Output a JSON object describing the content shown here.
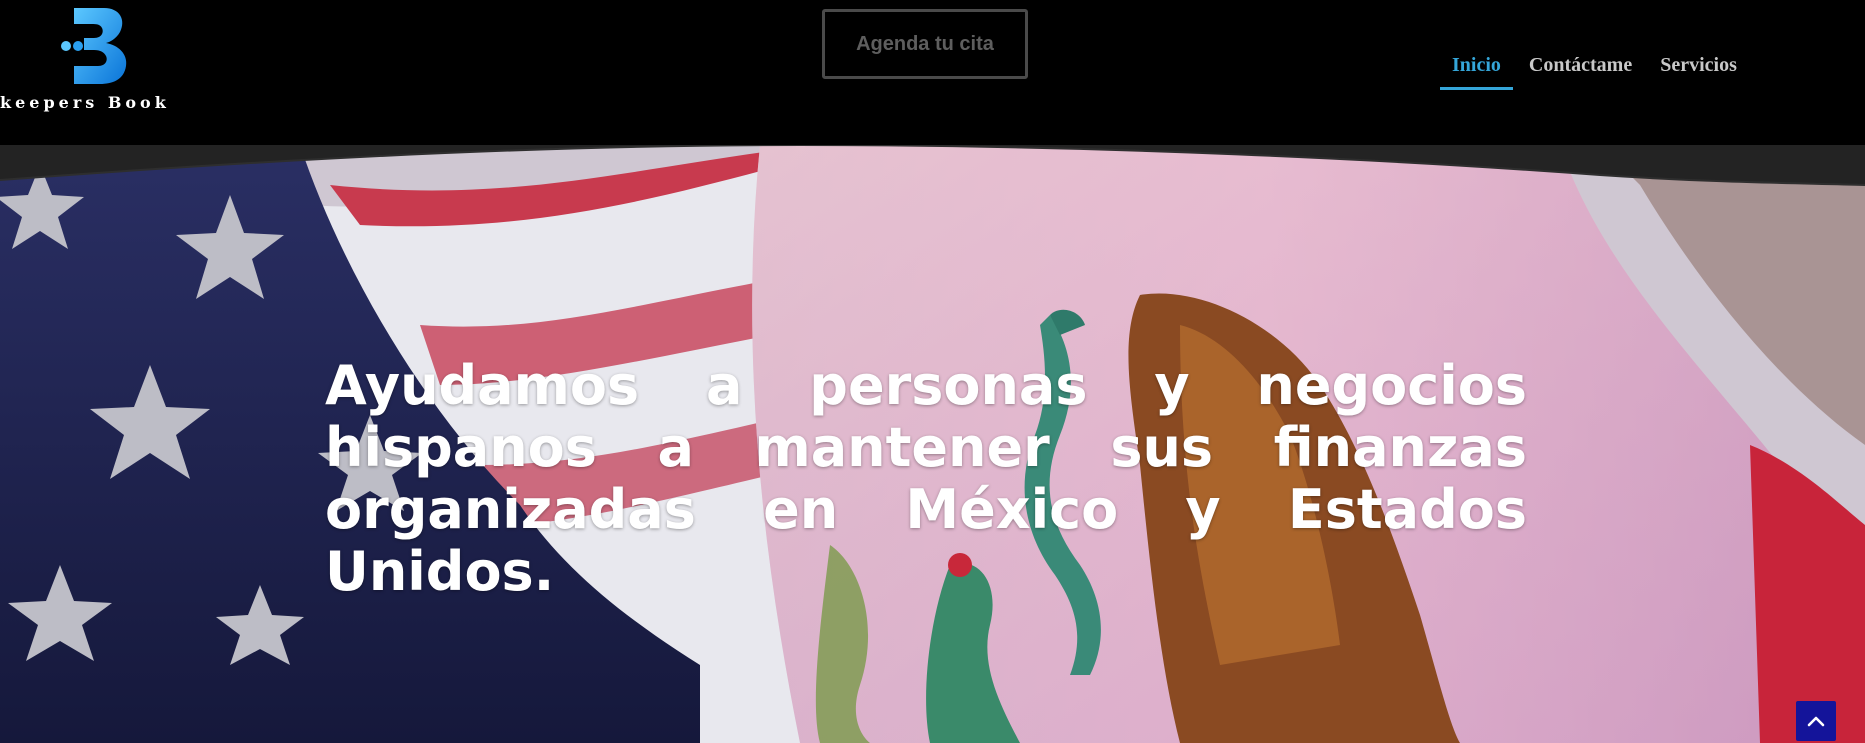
{
  "brand": {
    "logo_text": "keepers Book",
    "logo_icon": "letter-b-logo-icon",
    "color": "#1e9be8"
  },
  "header": {
    "cta_label": "Agenda tu cita",
    "nav": [
      {
        "label": "Inicio",
        "active": true
      },
      {
        "label": "Contáctame",
        "active": false
      },
      {
        "label": "Servicios",
        "active": false
      }
    ]
  },
  "hero": {
    "headline": "Ayudamos a personas y negocios hispanos a mantener sus finanzas organizadas en México y Estados Unidos.",
    "background": "us-mexico-flags-image"
  },
  "scroll_top": {
    "icon": "chevron-up-icon"
  },
  "colors": {
    "accent": "#35a6d9",
    "header_bg": "#000000",
    "cta_border": "#4a4a4a",
    "scroll_top_bg": "#14149a"
  }
}
